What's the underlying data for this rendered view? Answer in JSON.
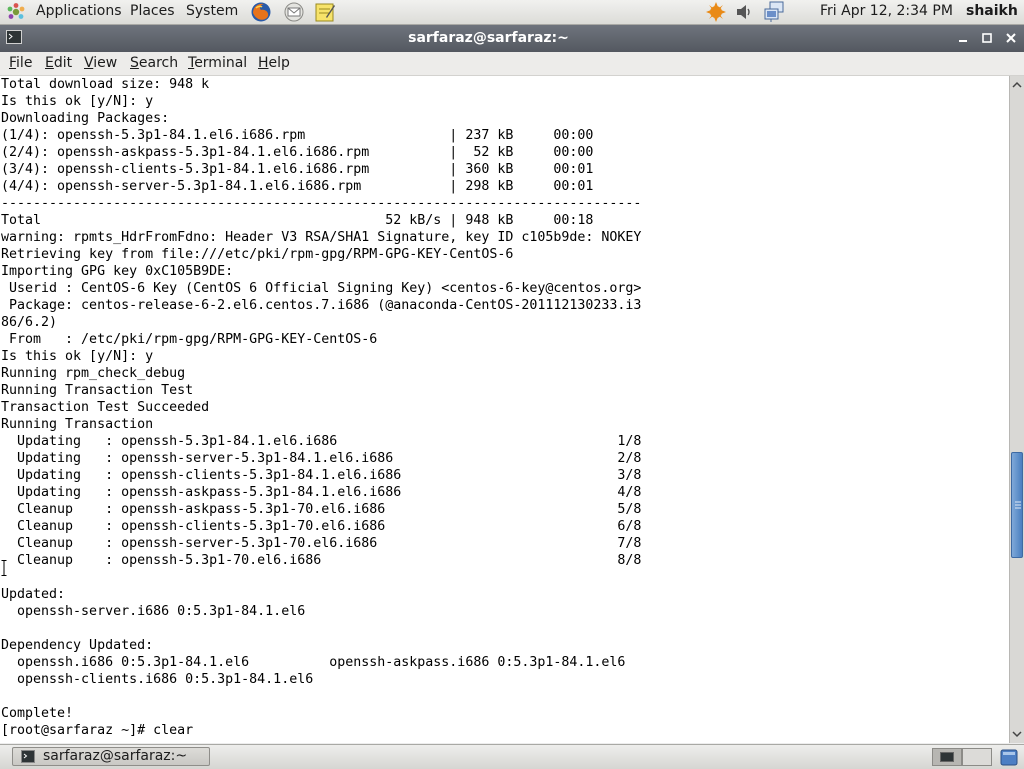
{
  "top_panel": {
    "menus": [
      "Applications",
      "Places",
      "System"
    ],
    "clock": "Fri Apr 12,  2:34 PM",
    "user": "shaikh",
    "launchers": [
      "firefox-icon",
      "mail-icon",
      "notes-icon"
    ],
    "tray": [
      "updates-icon",
      "volume-icon",
      "network-icon"
    ]
  },
  "window": {
    "title": "sarfaraz@sarfaraz:~"
  },
  "menubar": {
    "items": [
      {
        "pre": "",
        "u": "F",
        "post": "ile"
      },
      {
        "pre": "",
        "u": "E",
        "post": "dit"
      },
      {
        "pre": "",
        "u": "V",
        "post": "iew"
      },
      {
        "pre": "",
        "u": "S",
        "post": "earch"
      },
      {
        "pre": "",
        "u": "T",
        "post": "erminal"
      },
      {
        "pre": "",
        "u": "H",
        "post": "elp"
      }
    ]
  },
  "terminal": {
    "lines": [
      "Total download size: 948 k",
      "Is this ok [y/N]: y",
      "Downloading Packages:",
      "(1/4): openssh-5.3p1-84.1.el6.i686.rpm                  | 237 kB     00:00",
      "(2/4): openssh-askpass-5.3p1-84.1.el6.i686.rpm          |  52 kB     00:00",
      "(3/4): openssh-clients-5.3p1-84.1.el6.i686.rpm          | 360 kB     00:01",
      "(4/4): openssh-server-5.3p1-84.1.el6.i686.rpm           | 298 kB     00:01",
      "--------------------------------------------------------------------------------",
      "Total                                           52 kB/s | 948 kB     00:18",
      "warning: rpmts_HdrFromFdno: Header V3 RSA/SHA1 Signature, key ID c105b9de: NOKEY",
      "Retrieving key from file:///etc/pki/rpm-gpg/RPM-GPG-KEY-CentOS-6",
      "Importing GPG key 0xC105B9DE:",
      " Userid : CentOS-6 Key (CentOS 6 Official Signing Key) <centos-6-key@centos.org>",
      " Package: centos-release-6-2.el6.centos.7.i686 (@anaconda-CentOS-201112130233.i3",
      "86/6.2)",
      " From   : /etc/pki/rpm-gpg/RPM-GPG-KEY-CentOS-6",
      "Is this ok [y/N]: y",
      "Running rpm_check_debug",
      "Running Transaction Test",
      "Transaction Test Succeeded",
      "Running Transaction",
      "  Updating   : openssh-5.3p1-84.1.el6.i686                                   1/8",
      "  Updating   : openssh-server-5.3p1-84.1.el6.i686                            2/8",
      "  Updating   : openssh-clients-5.3p1-84.1.el6.i686                           3/8",
      "  Updating   : openssh-askpass-5.3p1-84.1.el6.i686                           4/8",
      "  Cleanup    : openssh-askpass-5.3p1-70.el6.i686                             5/8",
      "  Cleanup    : openssh-clients-5.3p1-70.el6.i686                             6/8",
      "  Cleanup    : openssh-server-5.3p1-70.el6.i686                              7/8",
      "  Cleanup    : openssh-5.3p1-70.el6.i686                                     8/8",
      "",
      "Updated:",
      "  openssh-server.i686 0:5.3p1-84.1.el6",
      "",
      "Dependency Updated:",
      "  openssh.i686 0:5.3p1-84.1.el6          openssh-askpass.i686 0:5.3p1-84.1.el6",
      "  openssh-clients.i686 0:5.3p1-84.1.el6",
      "",
      "Complete!",
      "[root@sarfaraz ~]# clear"
    ],
    "scroll_position": 0.68
  },
  "taskbar": {
    "task_label": "sarfaraz@sarfaraz:~"
  },
  "colors": {
    "titlebar": "#5d616a",
    "terminal_bg": "#ffffff",
    "scroll_thumb": "#4a7fc0"
  }
}
